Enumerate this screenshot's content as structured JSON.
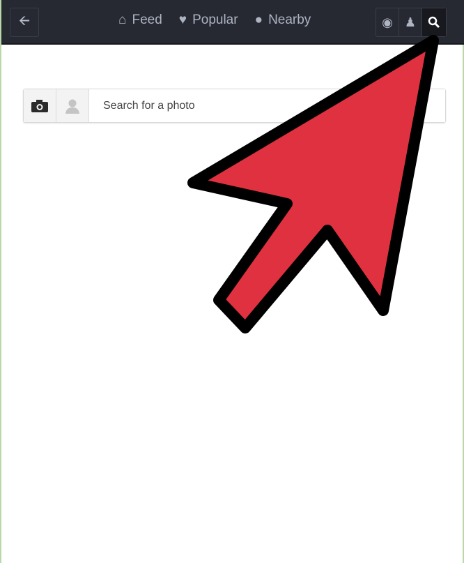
{
  "nav": {
    "back_icon": "arrow-left-icon",
    "links": [
      {
        "label": "Feed",
        "icon": "home-icon"
      },
      {
        "label": "Popular",
        "icon": "heart-icon"
      },
      {
        "label": "Nearby",
        "icon": "map-pin-icon"
      }
    ],
    "right_icons": [
      "chat-icon",
      "user-icon",
      "search-icon"
    ],
    "active_right": "search-icon"
  },
  "search": {
    "placeholder": "Search for a photo",
    "value": "",
    "icons": [
      "camera-icon",
      "user-icon"
    ]
  },
  "overlay": {
    "type": "pointer-arrow",
    "fill": "#e03140",
    "stroke": "#000000"
  }
}
